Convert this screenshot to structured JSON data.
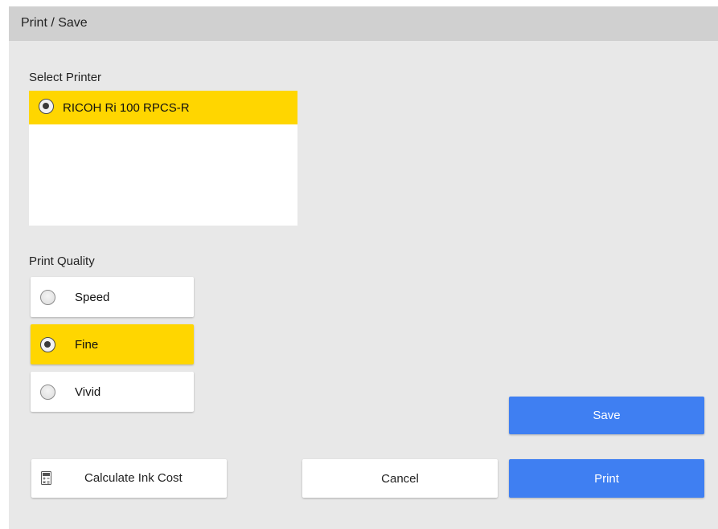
{
  "window": {
    "title": "Print / Save"
  },
  "printer_section": {
    "label": "Select Printer",
    "printers": [
      {
        "name": "RICOH Ri 100 RPCS-R",
        "selected": true
      }
    ]
  },
  "quality_section": {
    "label": "Print Quality",
    "options": [
      {
        "label": "Speed",
        "selected": false
      },
      {
        "label": "Fine",
        "selected": true
      },
      {
        "label": "Vivid",
        "selected": false
      }
    ]
  },
  "buttons": {
    "calculate_ink_cost": "Calculate Ink Cost",
    "cancel": "Cancel",
    "save": "Save",
    "print": "Print"
  },
  "colors": {
    "selected_highlight": "#ffd600",
    "primary_button": "#3f7ff2",
    "dialog_background": "#e8e8e8",
    "titlebar": "#d0d0d0"
  },
  "icons": {
    "ink_cost": "calculator-icon"
  }
}
